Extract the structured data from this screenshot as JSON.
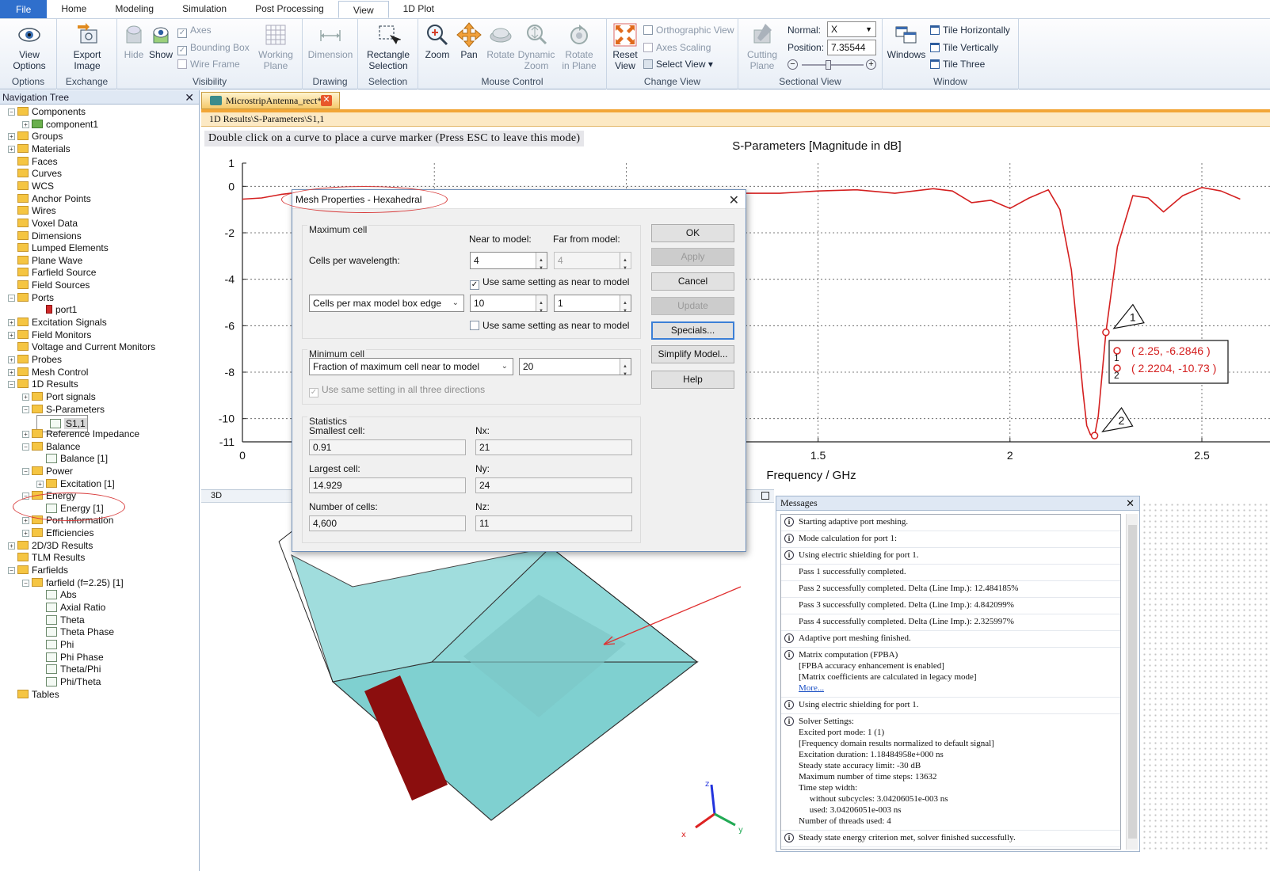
{
  "menubar": {
    "tabs": [
      "File",
      "Home",
      "Modeling",
      "Simulation",
      "Post Processing",
      "View",
      "1D Plot"
    ],
    "active": "View"
  },
  "ribbon": {
    "options": {
      "caption": "Options",
      "view_options": "View\nOptions"
    },
    "exchange": {
      "caption": "Exchange",
      "export_image": "Export\nImage"
    },
    "visibility": {
      "caption": "Visibility",
      "hide": "Hide",
      "show": "Show",
      "axes": "Axes",
      "bounding_box": "Bounding Box",
      "wire_frame": "Wire Frame",
      "working_plane": "Working\nPlane"
    },
    "drawing": {
      "caption": "Drawing",
      "dimension": "Dimension"
    },
    "selection": {
      "caption": "Selection",
      "rect_sel": "Rectangle\nSelection"
    },
    "mouse_control": {
      "caption": "Mouse Control",
      "zoom": "Zoom",
      "pan": "Pan",
      "rotate": "Rotate",
      "dynamic_zoom": "Dynamic\nZoom",
      "rotate_plane": "Rotate\nin Plane"
    },
    "change_view": {
      "caption": "Change View",
      "reset_view": "Reset\nView",
      "orthographic": "Orthographic View",
      "axes_scaling": "Axes Scaling",
      "select_view": "Select View"
    },
    "sectional_view": {
      "caption": "Sectional View",
      "cutting_plane": "Cutting\nPlane",
      "normal_label": "Normal:",
      "normal_value": "X",
      "position_label": "Position:",
      "position_value": "7.35544"
    },
    "window": {
      "caption": "Window",
      "windows": "Windows",
      "tile_h": "Tile Horizontally",
      "tile_v": "Tile Vertically",
      "tile_three": "Tile Three"
    }
  },
  "nav": {
    "title": "Navigation Tree",
    "items": [
      {
        "label": "Components",
        "level": 0,
        "exp": "−",
        "icon": "folder"
      },
      {
        "label": "component1",
        "level": 1,
        "exp": "+",
        "icon": "component"
      },
      {
        "label": "Groups",
        "level": 0,
        "exp": "+",
        "icon": "folder"
      },
      {
        "label": "Materials",
        "level": 0,
        "exp": "+",
        "icon": "folder"
      },
      {
        "label": "Faces",
        "level": 0,
        "exp": "",
        "icon": "folder"
      },
      {
        "label": "Curves",
        "level": 0,
        "exp": "",
        "icon": "folder"
      },
      {
        "label": "WCS",
        "level": 0,
        "exp": "",
        "icon": "folder"
      },
      {
        "label": "Anchor Points",
        "level": 0,
        "exp": "",
        "icon": "folder"
      },
      {
        "label": "Wires",
        "level": 0,
        "exp": "",
        "icon": "folder"
      },
      {
        "label": "Voxel Data",
        "level": 0,
        "exp": "",
        "icon": "folder"
      },
      {
        "label": "Dimensions",
        "level": 0,
        "exp": "",
        "icon": "folder"
      },
      {
        "label": "Lumped Elements",
        "level": 0,
        "exp": "",
        "icon": "folder"
      },
      {
        "label": "Plane Wave",
        "level": 0,
        "exp": "",
        "icon": "folder"
      },
      {
        "label": "Farfield Source",
        "level": 0,
        "exp": "",
        "icon": "folder"
      },
      {
        "label": "Field Sources",
        "level": 0,
        "exp": "",
        "icon": "folder"
      },
      {
        "label": "Ports",
        "level": 0,
        "exp": "−",
        "icon": "folder"
      },
      {
        "label": "port1",
        "level": 2,
        "exp": "",
        "icon": "port"
      },
      {
        "label": "Excitation Signals",
        "level": 0,
        "exp": "+",
        "icon": "folder"
      },
      {
        "label": "Field Monitors",
        "level": 0,
        "exp": "+",
        "icon": "folder"
      },
      {
        "label": "Voltage and Current Monitors",
        "level": 0,
        "exp": "",
        "icon": "folder"
      },
      {
        "label": "Probes",
        "level": 0,
        "exp": "+",
        "icon": "folder"
      },
      {
        "label": "Mesh Control",
        "level": 0,
        "exp": "+",
        "icon": "folder"
      },
      {
        "label": "1D Results",
        "level": 0,
        "exp": "−",
        "icon": "folder"
      },
      {
        "label": "Port signals",
        "level": 1,
        "exp": "+",
        "icon": "folder"
      },
      {
        "label": "S-Parameters",
        "level": 1,
        "exp": "−",
        "icon": "folder"
      },
      {
        "label": "S1,1",
        "level": 2,
        "exp": "",
        "icon": "result",
        "selected": true
      },
      {
        "label": "Reference Impedance",
        "level": 1,
        "exp": "+",
        "icon": "folder"
      },
      {
        "label": "Balance",
        "level": 1,
        "exp": "−",
        "icon": "folder"
      },
      {
        "label": "Balance [1]",
        "level": 2,
        "exp": "",
        "icon": "result"
      },
      {
        "label": "Power",
        "level": 1,
        "exp": "−",
        "icon": "folder"
      },
      {
        "label": "Excitation [1]",
        "level": 2,
        "exp": "+",
        "icon": "folder"
      },
      {
        "label": "Energy",
        "level": 1,
        "exp": "−",
        "icon": "folder"
      },
      {
        "label": "Energy [1]",
        "level": 2,
        "exp": "",
        "icon": "result"
      },
      {
        "label": "Port Information",
        "level": 1,
        "exp": "+",
        "icon": "folder"
      },
      {
        "label": "Efficiencies",
        "level": 1,
        "exp": "+",
        "icon": "folder"
      },
      {
        "label": "2D/3D Results",
        "level": 0,
        "exp": "+",
        "icon": "folder"
      },
      {
        "label": "TLM Results",
        "level": 0,
        "exp": "",
        "icon": "folder"
      },
      {
        "label": "Farfields",
        "level": 0,
        "exp": "−",
        "icon": "folder"
      },
      {
        "label": "farfield (f=2.25) [1]",
        "level": 1,
        "exp": "−",
        "icon": "folder"
      },
      {
        "label": "Abs",
        "level": 2,
        "exp": "",
        "icon": "result"
      },
      {
        "label": "Axial Ratio",
        "level": 2,
        "exp": "",
        "icon": "result"
      },
      {
        "label": "Theta",
        "level": 2,
        "exp": "",
        "icon": "result"
      },
      {
        "label": "Theta Phase",
        "level": 2,
        "exp": "",
        "icon": "result"
      },
      {
        "label": "Phi",
        "level": 2,
        "exp": "",
        "icon": "result"
      },
      {
        "label": "Phi Phase",
        "level": 2,
        "exp": "",
        "icon": "result"
      },
      {
        "label": "Theta/Phi",
        "level": 2,
        "exp": "",
        "icon": "result"
      },
      {
        "label": "Phi/Theta",
        "level": 2,
        "exp": "",
        "icon": "result"
      },
      {
        "label": "Tables",
        "level": 0,
        "exp": "",
        "icon": "folder"
      }
    ]
  },
  "document": {
    "tab": "MicrostripAntenna_rect*",
    "path": "1D Results\\S-Parameters\\S1,1",
    "hint": "Double click on a curve to place a curve marker (Press ESC to leave this mode)"
  },
  "chart_data": {
    "type": "line",
    "title": "S-Parameters [Magnitude in dB]",
    "xlabel": "Frequency / GHz",
    "ylabel": "",
    "xlim": [
      0,
      2.6
    ],
    "ylim": [
      -11,
      1
    ],
    "x_ticks": [
      0,
      1.5,
      2,
      2.5
    ],
    "y_ticks": [
      1,
      0,
      -2,
      -4,
      -6,
      -8,
      -10,
      -11
    ],
    "grid": true,
    "color": "#d42020",
    "series": [
      {
        "name": "",
        "x": [
          0,
          0.05,
          0.1,
          0.15,
          0.2,
          0.25,
          0.3,
          0.35,
          0.4,
          0.45,
          0.5,
          0.6,
          0.7,
          0.8,
          0.9,
          1.0,
          1.1,
          1.2,
          1.3,
          1.4,
          1.5,
          1.6,
          1.7,
          1.8,
          1.85,
          1.9,
          1.95,
          2.0,
          2.05,
          2.1,
          2.13,
          2.16,
          2.19,
          2.2,
          2.21,
          2.2204,
          2.23,
          2.25,
          2.28,
          2.32,
          2.36,
          2.4,
          2.45,
          2.5,
          2.55,
          2.6
        ],
        "y": [
          -0.55,
          -0.5,
          -0.35,
          -0.25,
          -0.3,
          -0.45,
          -0.4,
          -0.25,
          -0.3,
          -0.45,
          -0.35,
          -0.3,
          -0.4,
          -0.3,
          -0.35,
          -0.3,
          -0.35,
          -0.3,
          -0.3,
          -0.3,
          -0.2,
          -0.15,
          -0.3,
          -0.1,
          -0.2,
          -0.7,
          -0.6,
          -0.95,
          -0.5,
          -0.15,
          -1.0,
          -3.6,
          -8.8,
          -10.3,
          -10.7,
          -10.73,
          -9.9,
          -6.2846,
          -2.6,
          -0.4,
          -0.5,
          -1.1,
          -0.4,
          -0.05,
          -0.2,
          -0.55
        ]
      }
    ],
    "markers": [
      {
        "id": "1",
        "x": 2.25,
        "y": -6.2846,
        "label": "( 2.25, -6.2846 )"
      },
      {
        "id": "2",
        "x": 2.2204,
        "y": -10.73,
        "label": "( 2.2204, -10.73 )"
      }
    ]
  },
  "view3d": {
    "title": "3D"
  },
  "messages": {
    "title": "Messages",
    "items": [
      {
        "icon": true,
        "lines": [
          "Starting adaptive port meshing."
        ]
      },
      {
        "icon": true,
        "lines": [
          "Mode calculation for port 1:"
        ]
      },
      {
        "icon": true,
        "lines": [
          "Using electric shielding for port 1."
        ]
      },
      {
        "icon": false,
        "lines": [
          "Pass 1 successfully completed."
        ]
      },
      {
        "icon": false,
        "lines": [
          "Pass 2 successfully completed. Delta (Line Imp.): 12.484185%"
        ]
      },
      {
        "icon": false,
        "lines": [
          "Pass 3 successfully completed. Delta (Line Imp.): 4.842099%"
        ]
      },
      {
        "icon": false,
        "lines": [
          "Pass 4 successfully completed. Delta (Line Imp.): 2.325997%"
        ]
      },
      {
        "icon": true,
        "lines": [
          "Adaptive port meshing finished."
        ]
      },
      {
        "icon": true,
        "lines": [
          "Matrix computation (FPBA)",
          "[FPBA accuracy enhancement is enabled]",
          "[Matrix coefficients are calculated in legacy mode]"
        ],
        "link": "More..."
      },
      {
        "icon": true,
        "lines": [
          "Using electric shielding for port 1."
        ]
      },
      {
        "icon": true,
        "lines": [
          "Solver Settings:",
          "Excited port mode: 1 (1)",
          "[Frequency domain results normalized to default signal]",
          "Excitation duration: 1.18484958e+000 ns",
          "Steady state accuracy limit: -30 dB",
          "Maximum number of time steps: 13632",
          "Time step width:",
          "     without subcycles: 3.04206051e-003 ns",
          "     used: 3.04206051e-003 ns",
          "Number of threads used: 4"
        ]
      },
      {
        "icon": true,
        "lines": [
          "Steady state energy criterion met, solver finished successfully."
        ]
      }
    ]
  },
  "dialog": {
    "title": "Mesh Properties - Hexahedral",
    "max_cell": {
      "label": "Maximum cell",
      "near_label": "Near to model:",
      "far_label": "Far from model:",
      "cells_per_wl_label": "Cells per wavelength:",
      "cells_per_wl_near": "4",
      "cells_per_wl_far": "4",
      "same_setting_1": "Use same setting as near to model",
      "same_setting_1_checked": true,
      "edge_select": "Cells per max model box edge",
      "edge_near": "10",
      "edge_far": "1",
      "same_setting_2": "Use same setting as near to model",
      "same_setting_2_checked": false
    },
    "min_cell": {
      "label": "Minimum cell",
      "select": "Fraction of maximum cell near to model",
      "value": "20",
      "all_dirs": "Use same setting in all three directions"
    },
    "statistics": {
      "label": "Statistics",
      "smallest_label": "Smallest cell:",
      "smallest": "0.91",
      "largest_label": "Largest cell:",
      "largest": "14.929",
      "cells_label": "Number of cells:",
      "cells": "4,600",
      "nx_label": "Nx:",
      "nx": "21",
      "ny_label": "Ny:",
      "ny": "24",
      "nz_label": "Nz:",
      "nz": "11"
    },
    "buttons": {
      "ok": "OK",
      "apply": "Apply",
      "cancel": "Cancel",
      "update": "Update",
      "specials": "Specials...",
      "simplify": "Simplify Model...",
      "help": "Help"
    }
  }
}
